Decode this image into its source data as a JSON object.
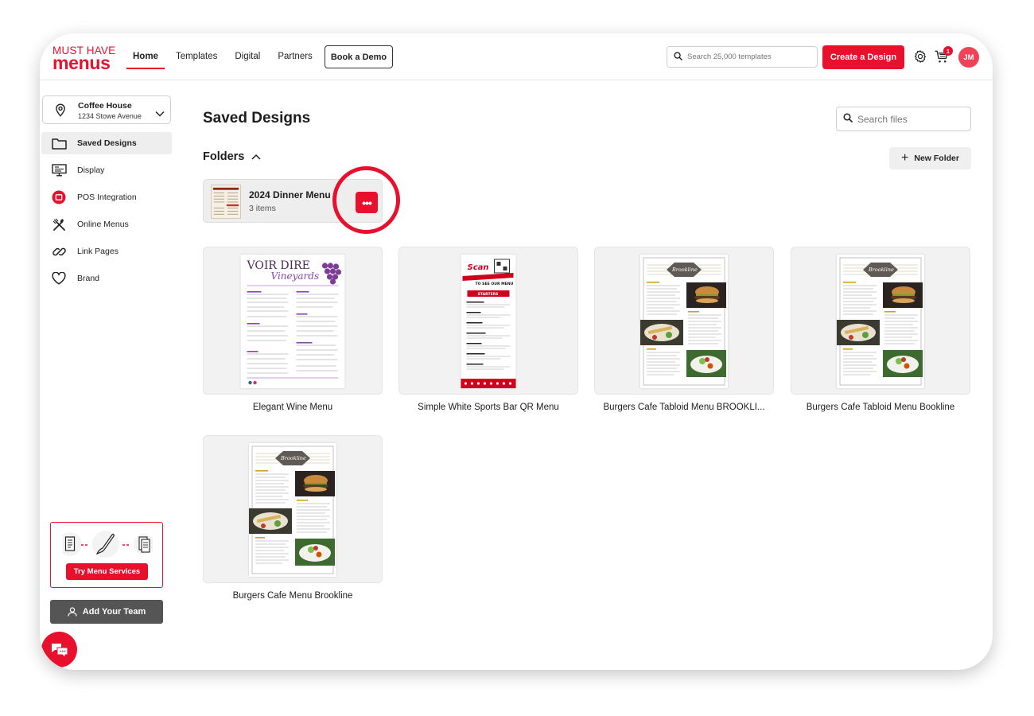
{
  "brand": {
    "line1": "MUST HAVE",
    "line2": "menus",
    "color": "#e8102d"
  },
  "nav": {
    "items": [
      {
        "label": "Home",
        "active": true
      },
      {
        "label": "Templates",
        "active": false
      },
      {
        "label": "Digital",
        "active": false
      },
      {
        "label": "Partners",
        "active": false
      }
    ],
    "demo_label": "Book a Demo"
  },
  "header": {
    "search_placeholder": "Search 25,000 templates",
    "create_label": "Create a Design",
    "cart_count": "1",
    "avatar_initials": "JM"
  },
  "location": {
    "name": "Coffee House",
    "address": "1234 Stowe Avenue"
  },
  "sidebar": {
    "items": [
      {
        "label": "Saved Designs",
        "icon": "folder-icon",
        "active": true
      },
      {
        "label": "Display",
        "icon": "display-icon",
        "active": false
      },
      {
        "label": "POS Integration",
        "icon": "pos-icon",
        "active": false
      },
      {
        "label": "Online Menus",
        "icon": "utensils-icon",
        "active": false
      },
      {
        "label": "Link Pages",
        "icon": "link-icon",
        "active": false
      },
      {
        "label": "Brand",
        "icon": "heart-icon",
        "active": false
      }
    ],
    "services_label": "Try Menu Services",
    "team_label": "Add Your Team"
  },
  "main": {
    "title": "Saved Designs",
    "search_placeholder": "Search files",
    "folders_label": "Folders",
    "new_folder_label": "New Folder",
    "folder": {
      "name": "2024 Dinner Menu",
      "count": "3 items"
    },
    "designs": [
      {
        "name": "Elegant Wine Menu"
      },
      {
        "name": "Simple White Sports Bar QR Menu"
      },
      {
        "name": "Burgers Cafe Tabloid Menu BROOKLI..."
      },
      {
        "name": "Burgers Cafe Tabloid Menu Bookline"
      },
      {
        "name": "Burgers Cafe Menu Brookline"
      }
    ],
    "thumb_text": {
      "wine_title1": "VOIR DIRE",
      "wine_title2": "Vineyards",
      "sports_scan": "Scan",
      "sports_sub": "TO SEE OUR MENU",
      "sports_banner": "STARTERS",
      "burger_brand": "Brookline"
    }
  },
  "colors": {
    "accent": "#e8102d",
    "dark_button": "#555555",
    "card_bg": "#f2f2f2"
  }
}
